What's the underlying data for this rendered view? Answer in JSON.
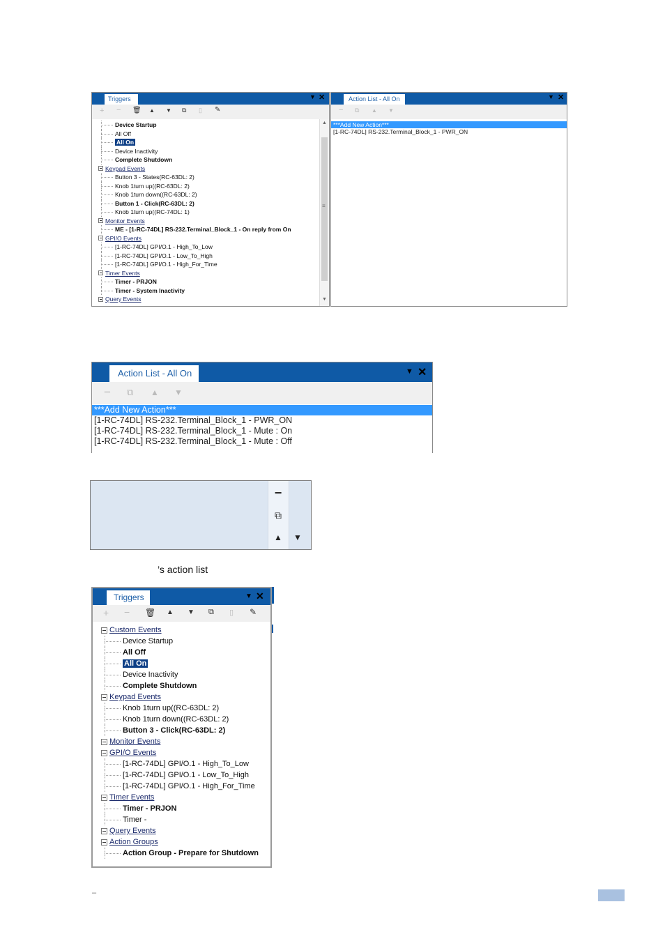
{
  "fig1": {
    "triggers": {
      "tab": "Triggers",
      "rows": [
        {
          "label": "Device Startup",
          "style": "bold"
        },
        {
          "label": "All Off",
          "style": "normal"
        },
        {
          "label": "All On",
          "style": "sel"
        },
        {
          "label": "Device Inactivity",
          "style": "normal"
        },
        {
          "label": "Complete Shutdown",
          "style": "bold"
        },
        {
          "label": "Keypad Events",
          "style": "group"
        },
        {
          "label": "Button 3 - States(RC-63DL: 2)",
          "style": "normal"
        },
        {
          "label": "Knob 1turn up((RC-63DL: 2)",
          "style": "normal"
        },
        {
          "label": "Knob 1turn down((RC-63DL: 2)",
          "style": "normal"
        },
        {
          "label": "Button 1 - Click(RC-63DL: 2)",
          "style": "bold"
        },
        {
          "label": "Knob 1turn up((RC-74DL: 1)",
          "style": "normal"
        },
        {
          "label": "Monitor Events",
          "style": "group"
        },
        {
          "label": "ME - [1-RC-74DL] RS-232.Terminal_Block_1 - On reply from On",
          "style": "bold"
        },
        {
          "label": "GPI/O Events",
          "style": "group"
        },
        {
          "label": "[1-RC-74DL] GPI/O.1 - High_To_Low",
          "style": "normal"
        },
        {
          "label": "[1-RC-74DL] GPI/O.1 - Low_To_High",
          "style": "normal"
        },
        {
          "label": "[1-RC-74DL] GPI/O.1 - High_For_Time",
          "style": "normal"
        },
        {
          "label": "Timer Events",
          "style": "group"
        },
        {
          "label": "Timer - PRJON",
          "style": "bold"
        },
        {
          "label": "Timer - System Inactivity",
          "style": "bold"
        },
        {
          "label": "Query Events",
          "style": "group"
        }
      ]
    },
    "actionlist": {
      "tab": "Action List - All On",
      "rows": [
        {
          "label": "***Add New Action***",
          "style": "sel"
        },
        {
          "label": "[1-RC-74DL] RS-232.Terminal_Block_1 - PWR_ON",
          "style": "normal"
        }
      ]
    }
  },
  "fig2": {
    "tab": "Action List - All On",
    "rows": [
      {
        "label": "***Add New Action***",
        "style": "sel"
      },
      {
        "label": "[1-RC-74DL] RS-232.Terminal_Block_1 - PWR_ON",
        "style": "normal"
      },
      {
        "label": "[1-RC-74DL] RS-232.Terminal_Block_1 - Mute : On",
        "style": "normal"
      },
      {
        "label": "[1-RC-74DL] RS-232.Terminal_Block_1 - Mute : Off",
        "style": "normal"
      }
    ]
  },
  "caption": "’s action list",
  "fig4": {
    "tab": "Triggers",
    "rows": [
      {
        "label": "Custom Events",
        "style": "group"
      },
      {
        "label": "Device Startup",
        "style": "normal"
      },
      {
        "label": "All Off",
        "style": "bold"
      },
      {
        "label": "All On",
        "style": "sel"
      },
      {
        "label": "Device Inactivity",
        "style": "normal"
      },
      {
        "label": "Complete Shutdown",
        "style": "bold"
      },
      {
        "label": "Keypad Events",
        "style": "group"
      },
      {
        "label": "Knob 1turn up((RC-63DL: 2)",
        "style": "normal"
      },
      {
        "label": "Knob 1turn down((RC-63DL: 2)",
        "style": "normal"
      },
      {
        "label": "Button 3 - Click(RC-63DL: 2)",
        "style": "bold"
      },
      {
        "label": "Monitor Events",
        "style": "group"
      },
      {
        "label": "GPI/O Events",
        "style": "group"
      },
      {
        "label": "[1-RC-74DL] GPI/O.1 - High_To_Low",
        "style": "normal"
      },
      {
        "label": "[1-RC-74DL] GPI/O.1 - Low_To_High",
        "style": "normal"
      },
      {
        "label": "[1-RC-74DL] GPI/O.1 - High_For_Time",
        "style": "normal"
      },
      {
        "label": "Timer Events",
        "style": "group"
      },
      {
        "label": "Timer - PRJON",
        "style": "bold"
      },
      {
        "label": "Timer -",
        "style": "normal"
      },
      {
        "label": "Query Events",
        "style": "group"
      },
      {
        "label": "Action Groups",
        "style": "group"
      },
      {
        "label": "Action Group - Prepare for Shutdown",
        "style": "bold"
      }
    ]
  },
  "footer": {
    "dash": "–"
  },
  "colors": {
    "titlebar": "#0f5aa6",
    "selection_tree": "#0d3f86",
    "selection_list": "#3399ff",
    "toolbar_strip": "#dce6f2",
    "page_tag": "#a9c1e0"
  }
}
